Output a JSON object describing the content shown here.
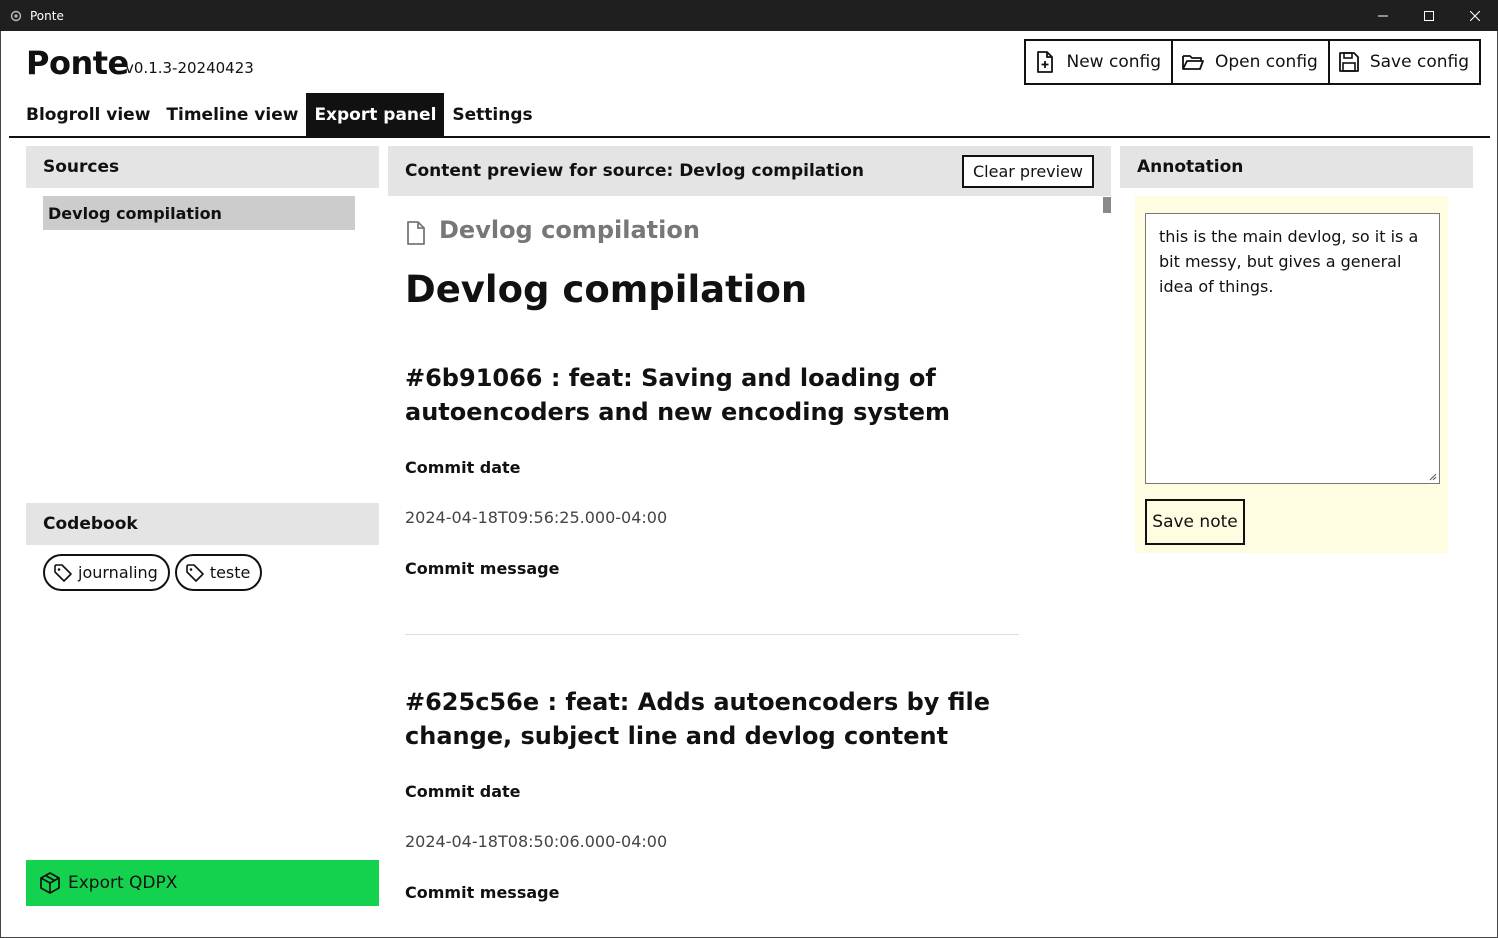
{
  "window": {
    "title": "Ponte",
    "icon": "ponte-app-icon",
    "controls": [
      "minimize-icon",
      "maximize-icon",
      "close-icon"
    ]
  },
  "header": {
    "app_name": "Ponte",
    "version": "v0.1.3-20240423"
  },
  "config_toolbar": {
    "new_label": "New config",
    "open_label": "Open config",
    "save_label": "Save config"
  },
  "tabs": [
    {
      "label": "Blogroll view",
      "active": false
    },
    {
      "label": "Timeline view",
      "active": false
    },
    {
      "label": "Export panel",
      "active": true
    },
    {
      "label": "Settings",
      "active": false
    }
  ],
  "sources": {
    "heading": "Sources",
    "items": [
      {
        "label": "Devlog compilation",
        "selected": true
      }
    ]
  },
  "codebook": {
    "heading": "Codebook",
    "tags": [
      {
        "label": "journaling"
      },
      {
        "label": "teste"
      }
    ]
  },
  "export": {
    "label": "Export QDPX",
    "color": "#15d24e"
  },
  "preview": {
    "heading": "Content preview for source: Devlog compilation",
    "clear_label": "Clear preview",
    "doc_title": "Devlog compilation",
    "h1": "Devlog compilation",
    "commits": [
      {
        "title": "#6b91066 : feat: Saving and loading of autoencoders and new encoding system",
        "date_label": "Commit date",
        "date": "2024-04-18T09:56:25.000-04:00",
        "message_label": "Commit message"
      },
      {
        "title": "#625c56e : feat: Adds autoencoders by file change, subject line and devlog content",
        "date_label": "Commit date",
        "date": "2024-04-18T08:50:06.000-04:00",
        "message_label": "Commit message"
      }
    ]
  },
  "annotation": {
    "heading": "Annotation",
    "note": "this is the main devlog, so it is a bit messy, but gives a general idea of things.",
    "save_label": "Save note",
    "background": "#fefde1"
  }
}
